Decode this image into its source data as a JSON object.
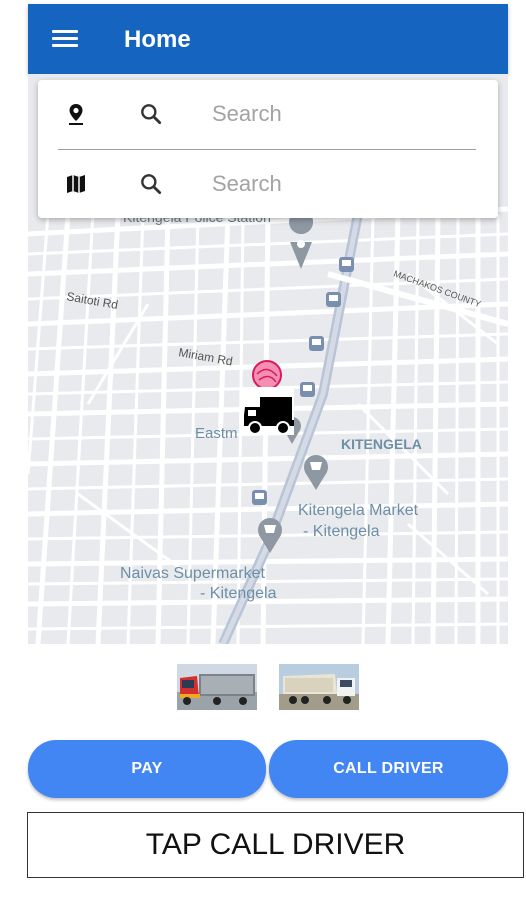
{
  "header": {
    "title": "Home",
    "menu_icon": "hamburger-menu-icon",
    "color": "#1565c0"
  },
  "search": {
    "origin": {
      "placeholder": "Search",
      "value": "",
      "row_icon": "location-pin-icon",
      "search_icon": "search-icon"
    },
    "destination": {
      "placeholder": "Search",
      "value": "",
      "row_icon": "map-icon",
      "search_icon": "search-icon"
    }
  },
  "map": {
    "labels": {
      "police_station": "Kitengela Police Station",
      "saitoti_rd": "Saitoti Rd",
      "miriam_rd": "Miriam Rd",
      "machakos_county": "MACHAKOS COUNTY",
      "eastmatt": "Eastm",
      "kitengela": "KITENGELA",
      "market_line1": "Kitengela Market",
      "market_line2": "- Kitengela",
      "naivas_line1": "Naivas Supermarket",
      "naivas_line2": "- Kitengela"
    },
    "markers": {
      "truck": "truck-icon",
      "user_location": "pink-location-dot-icon",
      "bus_stop": "bus-stop-icon",
      "shopping": "shopping-cart-icon",
      "police": "police-marker-icon"
    }
  },
  "vehicles": [
    {
      "name": "vehicle-thumbnail-1",
      "icon": "red-truck-image"
    },
    {
      "name": "vehicle-thumbnail-2",
      "icon": "tipper-truck-image"
    }
  ],
  "actions": {
    "pay_label": "PAY",
    "call_label": "CALL DRIVER",
    "button_color": "#4286f4"
  },
  "instruction": "TAP CALL DRIVER"
}
